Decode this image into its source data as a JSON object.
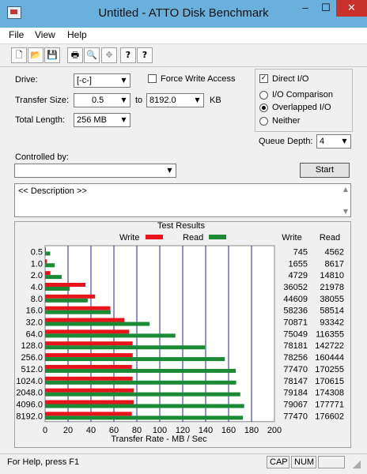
{
  "window": {
    "title": "Untitled - ATTO Disk Benchmark",
    "minimize": "‒",
    "maximize": "☐",
    "close": "✕"
  },
  "menu": [
    "File",
    "View",
    "Help"
  ],
  "toolbar": {
    "icons": [
      "new-file-icon",
      "open-folder-icon",
      "save-disk-icon",
      "print-icon",
      "print-preview-icon",
      "move-icon",
      "help-icon",
      "context-help-icon"
    ],
    "glyphs": [
      "🗋",
      "📂",
      "💾",
      "🖶",
      "🔍",
      "✥",
      "?",
      "?"
    ]
  },
  "settings": {
    "drive_label": "Drive:",
    "drive_value": "[-c-]",
    "force_write_label": "Force Write Access",
    "force_write_checked": false,
    "direct_io_label": "Direct I/O",
    "direct_io_checked": true,
    "transfer_size_label": "Transfer Size:",
    "transfer_from": "0.5",
    "transfer_to_label": "to",
    "transfer_to": "8192.0",
    "transfer_unit": "KB",
    "total_length_label": "Total Length:",
    "total_length": "256 MB",
    "io_comparison_label": "I/O Comparison",
    "overlapped_io_label": "Overlapped I/O",
    "neither_label": "Neither",
    "selected_mode": "Overlapped I/O",
    "queue_depth_label": "Queue Depth:",
    "queue_depth": "4",
    "controlled_by_label": "Controlled by:",
    "controlled_by_value": "",
    "start_label": "Start",
    "description": "<< Description >>"
  },
  "results_title": "Test Results",
  "status": {
    "help": "For Help, press F1",
    "caps": "CAP",
    "num": "NUM",
    "extra": ""
  },
  "chart_data": {
    "type": "bar",
    "orientation": "horizontal",
    "title": "Test Results",
    "xlabel": "Transfer Rate - MB / Sec",
    "xlim": [
      0,
      200
    ],
    "xticks": [
      0,
      20,
      40,
      60,
      80,
      100,
      120,
      140,
      160,
      180,
      200
    ],
    "categories": [
      "0.5",
      "1.0",
      "2.0",
      "4.0",
      "8.0",
      "16.0",
      "32.0",
      "64.0",
      "128.0",
      "256.0",
      "512.0",
      "1024.0",
      "2048.0",
      "4096.0",
      "8192.0"
    ],
    "series": [
      {
        "name": "Write",
        "color": "#e8141c",
        "values": [
          0.73,
          1.62,
          4.62,
          35.21,
          43.56,
          56.87,
          69.21,
          73.29,
          76.35,
          76.42,
          75.65,
          76.32,
          77.33,
          77.21,
          75.65
        ],
        "labels": [
          "745",
          "1655",
          "4729",
          "36052",
          "44609",
          "58236",
          "70871",
          "75049",
          "78181",
          "78256",
          "77470",
          "78147",
          "79184",
          "79067",
          "77470"
        ]
      },
      {
        "name": "Read",
        "color": "#1a8a34",
        "values": [
          4.46,
          8.42,
          14.46,
          21.46,
          37.16,
          57.14,
          91.15,
          113.63,
          139.38,
          156.68,
          166.26,
          166.62,
          170.22,
          173.6,
          172.46
        ],
        "labels": [
          "4562",
          "8617",
          "14810",
          "21978",
          "38055",
          "58514",
          "93342",
          "116355",
          "142722",
          "160444",
          "170255",
          "170615",
          "174308",
          "177771",
          "176602"
        ]
      }
    ],
    "grid": true,
    "legend": "top"
  }
}
